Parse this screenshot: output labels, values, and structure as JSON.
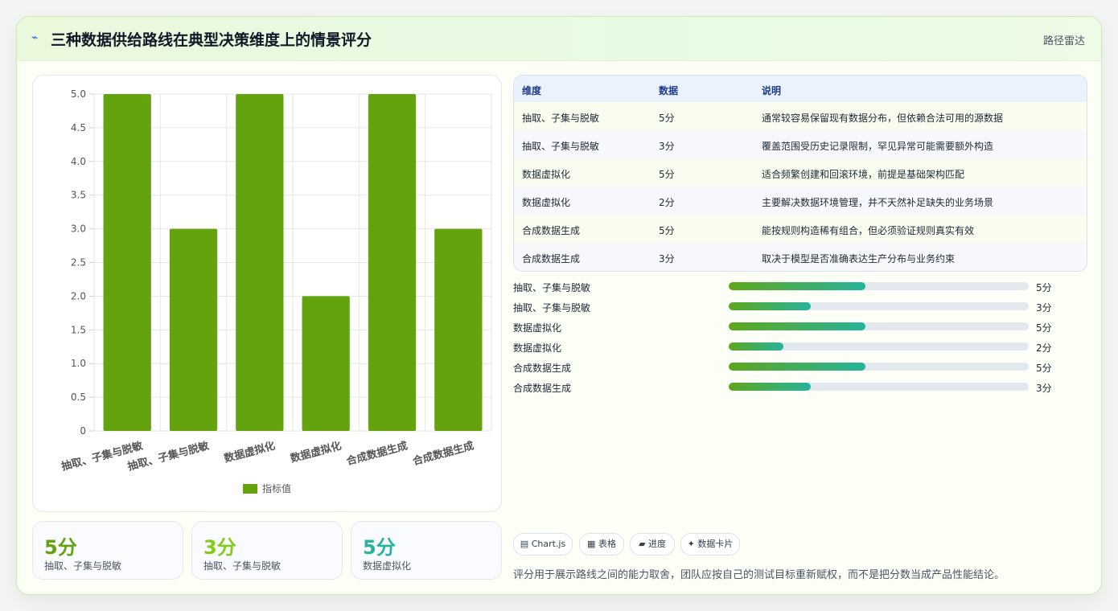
{
  "header": {
    "icon": "chart-line-icon",
    "title": "三种数据供给路线在典型决策维度上的情景评分",
    "right_label": "路径雷达"
  },
  "chart_data": {
    "type": "bar",
    "categories": [
      "抽取、子集与脱敏",
      "抽取、子集与脱敏",
      "数据虚拟化",
      "数据虚拟化",
      "合成数据生成",
      "合成数据生成"
    ],
    "series": [
      {
        "name": "指标值",
        "values": [
          5,
          3,
          5,
          2,
          5,
          3
        ],
        "color": "#63a30e"
      }
    ],
    "ylim": [
      0,
      5
    ],
    "yticks": [
      "5.0",
      "4.5",
      "4.0",
      "3.5",
      "3.0",
      "2.5",
      "2.0",
      "1.5",
      "1.0",
      "0.5",
      "0"
    ],
    "grid": true,
    "legend": "bottom"
  },
  "stats": [
    {
      "value": "5分",
      "label": "抽取、子集与脱敏",
      "color": "#63a30e"
    },
    {
      "value": "3分",
      "label": "抽取、子集与脱敏",
      "color": "#84cc16"
    },
    {
      "value": "5分",
      "label": "数据虚拟化",
      "color": "#26b39c"
    }
  ],
  "table": {
    "headers": [
      "维度",
      "数据",
      "说明"
    ],
    "rows": [
      [
        "抽取、子集与脱敏",
        "5分",
        "通常较容易保留现有数据分布，但依赖合法可用的源数据"
      ],
      [
        "抽取、子集与脱敏",
        "3分",
        "覆盖范围受历史记录限制，罕见异常可能需要额外构造"
      ],
      [
        "数据虚拟化",
        "5分",
        "适合频繁创建和回滚环境，前提是基础架构匹配"
      ],
      [
        "数据虚拟化",
        "2分",
        "主要解决数据环境管理，并不天然补足缺失的业务场景"
      ],
      [
        "合成数据生成",
        "5分",
        "能按规则构造稀有组合，但必须验证规则真实有效"
      ],
      [
        "合成数据生成",
        "3分",
        "取决于模型是否准确表达生产分布与业务约束"
      ]
    ]
  },
  "progress": {
    "max": 11,
    "items": [
      {
        "label": "抽取、子集与脱敏",
        "value": 5,
        "text": "5分"
      },
      {
        "label": "抽取、子集与脱敏",
        "value": 3,
        "text": "3分"
      },
      {
        "label": "数据虚拟化",
        "value": 5,
        "text": "5分"
      },
      {
        "label": "数据虚拟化",
        "value": 2,
        "text": "2分"
      },
      {
        "label": "合成数据生成",
        "value": 5,
        "text": "5分"
      },
      {
        "label": "合成数据生成",
        "value": 3,
        "text": "3分"
      }
    ]
  },
  "chips": [
    "Chart.js",
    "表格",
    "进度",
    "数据卡片"
  ],
  "chip_icons": [
    "chart-icon",
    "table-icon",
    "progress-icon",
    "card-icon"
  ],
  "footnote": "评分用于展示路线之间的能力取舍，团队应按自己的测试目标重新赋权，而不是把分数当成产品性能结论。"
}
